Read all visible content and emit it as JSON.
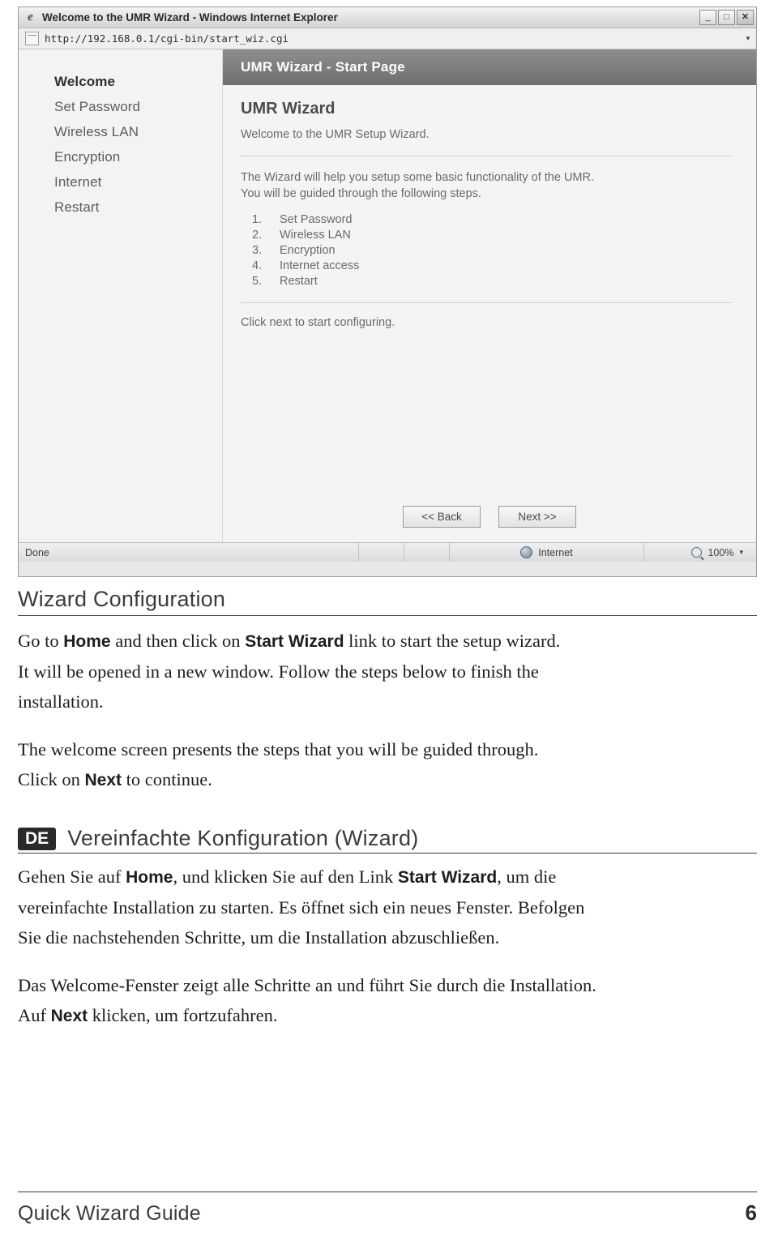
{
  "screenshot": {
    "window_title": "Welcome to the UMR Wizard - Windows Internet Explorer",
    "minimize_label": "_",
    "maximize_label": "□",
    "close_label": "✕",
    "address": "http://192.168.0.1/cgi-bin/start_wiz.cgi",
    "sidebar": [
      {
        "label": "Welcome",
        "active": true
      },
      {
        "label": "Set Password",
        "active": false
      },
      {
        "label": "Wireless LAN",
        "active": false
      },
      {
        "label": "Encryption",
        "active": false
      },
      {
        "label": "Internet",
        "active": false
      },
      {
        "label": "Restart",
        "active": false
      }
    ],
    "page_header": "UMR Wizard - Start Page",
    "heading": "UMR Wizard",
    "subheading": "Welcome to the UMR Setup Wizard.",
    "intro_line1": "The Wizard will help you setup some basic functionality of the UMR.",
    "intro_line2": "You will be guided through the following steps.",
    "steps": [
      {
        "num": "1.",
        "label": "Set Password"
      },
      {
        "num": "2.",
        "label": "Wireless LAN"
      },
      {
        "num": "3.",
        "label": "Encryption"
      },
      {
        "num": "4.",
        "label": "Internet access"
      },
      {
        "num": "5.",
        "label": "Restart"
      }
    ],
    "closing": "Click next to start configuring.",
    "back_button": "<< Back",
    "next_button": "Next >>",
    "status_done": "Done",
    "status_zone": "Internet",
    "status_zoom": "100%",
    "status_zoom_caret": "▾",
    "address_caret": "▾"
  },
  "section_en": {
    "title": "Wizard Configuration",
    "p1_a": "Go to ",
    "p1_b": "Home",
    "p1_c": " and then click on ",
    "p1_d": "Start Wizard",
    "p1_e": " link to start the setup wizard.",
    "p1_line2": "It will be opened in a new window. Follow the steps below to finish the",
    "p1_line3": "installation.",
    "p2_line1": "The welcome screen presents the steps that you will be guided through.",
    "p2_a": "Click on ",
    "p2_b": "Next",
    "p2_c": " to continue."
  },
  "section_de": {
    "badge": "DE",
    "title": "Vereinfachte Konfiguration (Wizard)",
    "p1_a": "Gehen Sie auf ",
    "p1_b": "Home",
    "p1_c": ", und klicken Sie auf den Link ",
    "p1_d": "Start Wizard",
    "p1_e": ", um die",
    "p1_line2": "vereinfachte Installation zu starten. Es öffnet sich ein neues Fenster. Befolgen",
    "p1_line3": "Sie die nachstehenden Schritte, um die Installation abzuschließen.",
    "p2_line1": "Das Welcome-Fenster zeigt alle Schritte an und führt Sie durch die Installation.",
    "p2_a": "Auf ",
    "p2_b": "Next",
    "p2_c": " klicken, um fortzufahren."
  },
  "footer": {
    "text": "Quick Wizard Guide",
    "page": "6"
  }
}
